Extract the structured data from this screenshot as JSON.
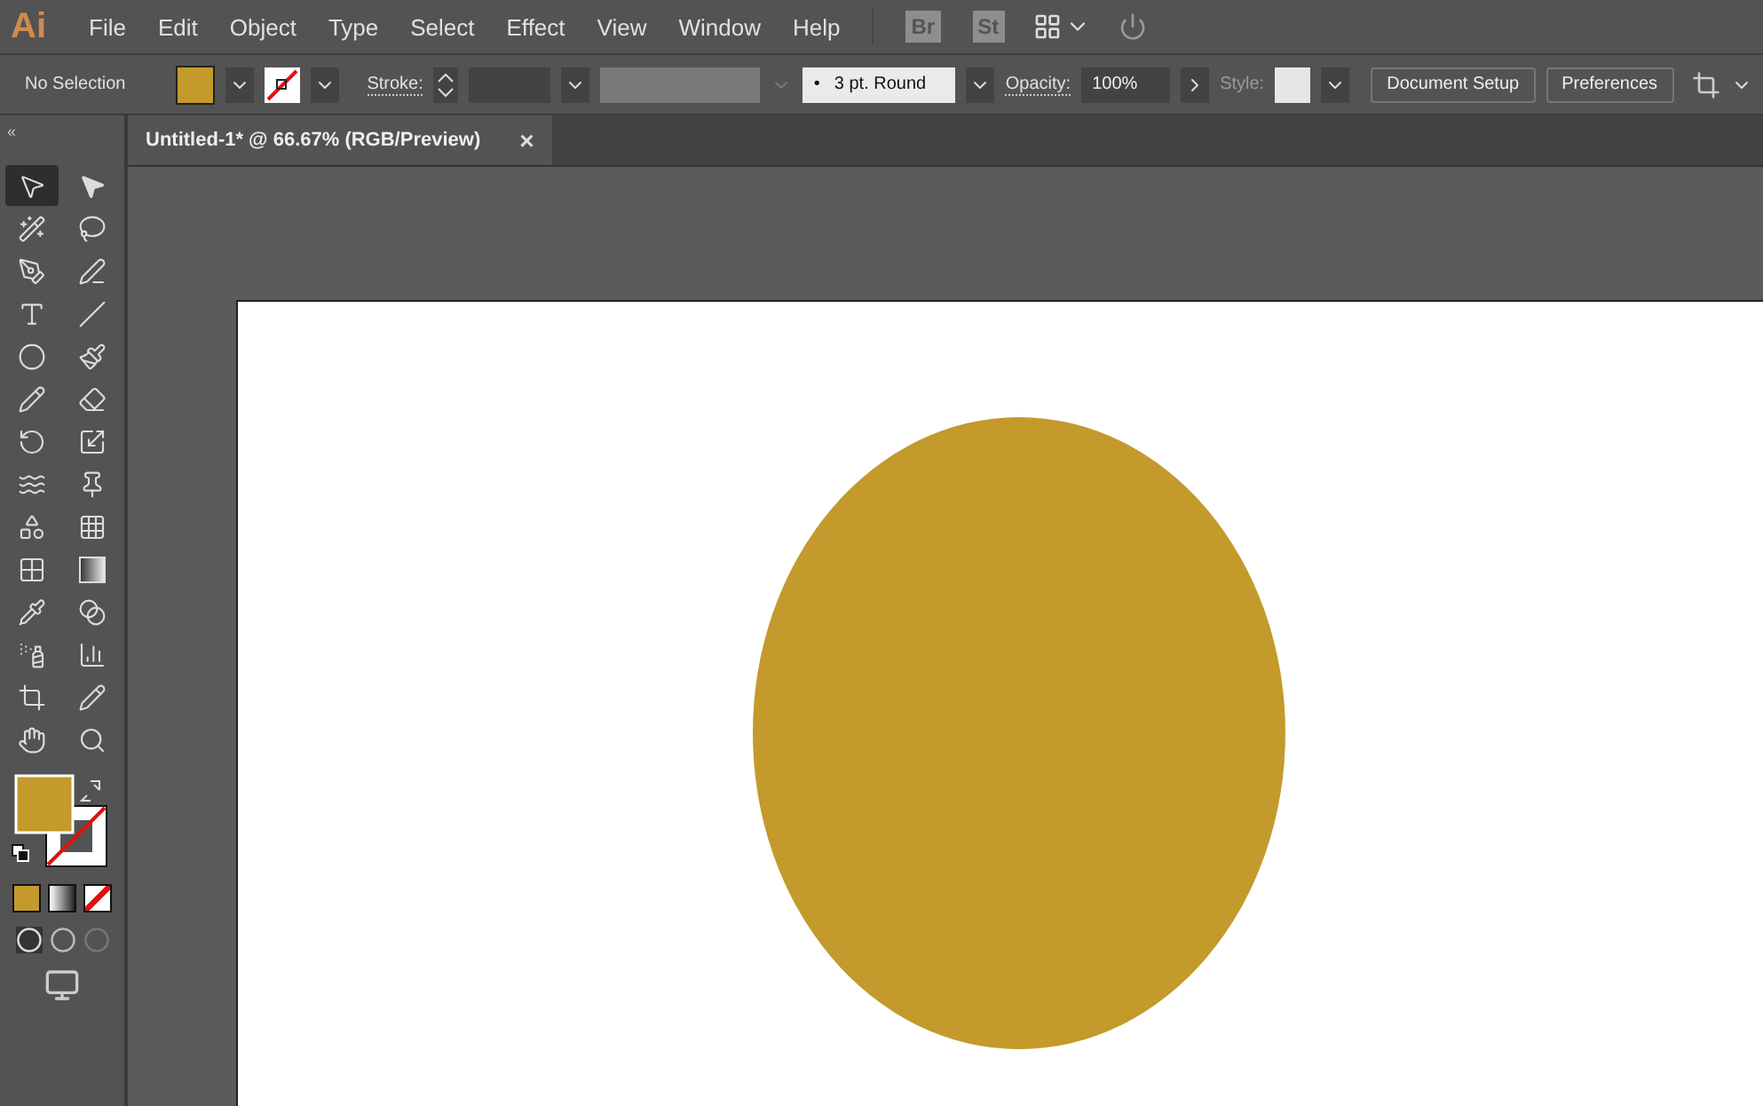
{
  "app": {
    "logo": "Ai"
  },
  "menu": [
    "File",
    "Edit",
    "Object",
    "Type",
    "Select",
    "Effect",
    "View",
    "Window",
    "Help"
  ],
  "app_bar": {
    "bridge": "Br",
    "stock": "St"
  },
  "control_bar": {
    "selection": "No Selection",
    "stroke_label": "Stroke:",
    "brush": "3 pt. Round",
    "brush_dot": "•",
    "opacity_label": "Opacity:",
    "opacity": "100%",
    "style_label": "Style:",
    "buttons": [
      "Document Setup",
      "Preferences"
    ]
  },
  "document_tab": {
    "title": "Untitled-1* @ 66.67% (RGB/Preview)",
    "close": "×"
  },
  "tool_panel": {
    "collapse": "«"
  },
  "tools": [
    {
      "kind": "arrow",
      "selected": true
    },
    {
      "kind": "direct",
      "selected": false
    },
    {
      "kind": "wand",
      "selected": false
    },
    {
      "kind": "lasso",
      "selected": false
    },
    {
      "kind": "pen",
      "selected": false
    },
    {
      "kind": "penline",
      "selected": false
    },
    {
      "kind": "type",
      "selected": false
    },
    {
      "kind": "line",
      "selected": false
    },
    {
      "kind": "ellipse",
      "selected": false
    },
    {
      "kind": "brush",
      "selected": false
    },
    {
      "kind": "shaper",
      "selected": false
    },
    {
      "kind": "eraser",
      "selected": false
    },
    {
      "kind": "rotate",
      "selected": false
    },
    {
      "kind": "scale",
      "selected": false
    },
    {
      "kind": "waves",
      "selected": false
    },
    {
      "kind": "pin",
      "selected": false
    },
    {
      "kind": "shapes",
      "selected": false
    },
    {
      "kind": "grid",
      "selected": false
    },
    {
      "kind": "mesh",
      "selected": false
    },
    {
      "kind": "gradient",
      "selected": false
    },
    {
      "kind": "pipette",
      "selected": false
    },
    {
      "kind": "blend",
      "selected": false
    },
    {
      "kind": "spray",
      "selected": false
    },
    {
      "kind": "chart",
      "selected": false
    },
    {
      "kind": "crop",
      "selected": false
    },
    {
      "kind": "pencil",
      "selected": false
    },
    {
      "kind": "hand",
      "selected": false
    },
    {
      "kind": "zoom",
      "selected": false
    }
  ]
}
